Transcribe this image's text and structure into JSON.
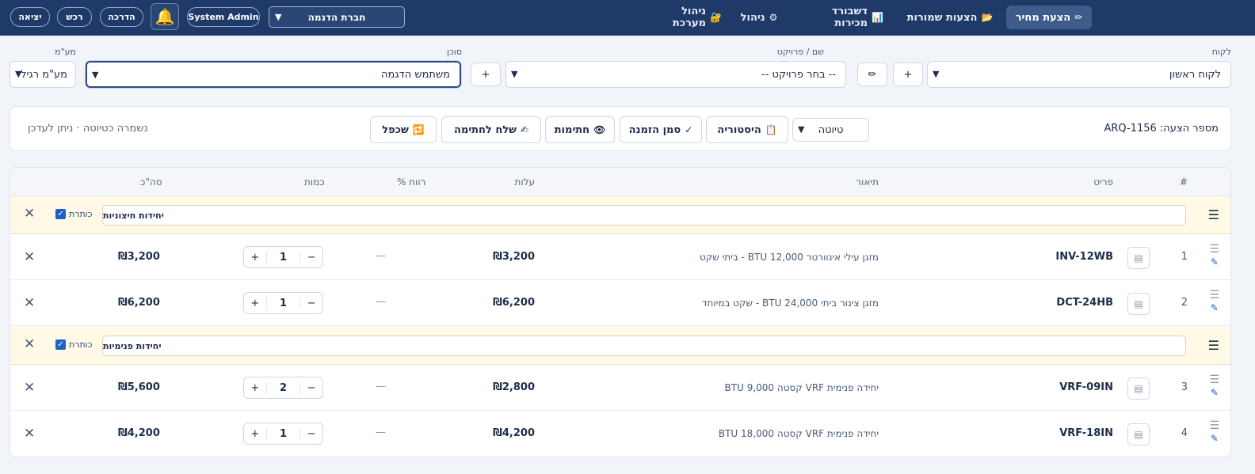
{
  "header": {
    "buttons": {
      "logout": "יציאה",
      "purchase": "רכש",
      "guide": "הדרכה",
      "user": "System Admin"
    },
    "company": "חברת הדגמה",
    "nav": [
      {
        "label": "הצעת מחיר",
        "icon": "✏"
      },
      {
        "label": "הצעות שמורות",
        "icon": "📂"
      },
      {
        "label": "דשבורד מכירות",
        "icon": "📊"
      },
      {
        "label": "ניהול",
        "icon": "⚙"
      },
      {
        "label": "ניהול מערכת",
        "icon": "🔐"
      }
    ]
  },
  "filters": {
    "customer_label": "לקוח",
    "customer_value": "לקוח ראשון",
    "project_label": "שם / פרויקט",
    "project_value": "-- בחר פרויקט --",
    "agent_label": "סוכן",
    "agent_value": "משתמש הדגמה",
    "vat_label": "מע\"מ",
    "vat_value": "מע\"מ רגיל",
    "plus": "+",
    "edit_icon": "✏"
  },
  "proposal": {
    "number": "מספר הצעה: ARQ-1156",
    "saved_status": "נשמרה כטיוטה · ניתן לעדכן",
    "status_value": "טיוטה",
    "buttons": {
      "history": "היסטוריה",
      "mark_order": "סמן הזמנה",
      "signatures": "חתימות",
      "send_signature": "שלח לחתימה",
      "duplicate": "שכפל"
    },
    "icons": {
      "history": "📋",
      "mark_order": "✓",
      "signatures": "👁",
      "send_signature": "✍",
      "duplicate": "🔁"
    }
  },
  "table": {
    "headers": {
      "index": "#",
      "item": "פריט",
      "description": "תיאור",
      "cost": "עלות",
      "profit": "רווח %",
      "quantity": "כמות",
      "total": "סה\"כ"
    },
    "header_checkbox_label": "כותרת",
    "groups": [
      {
        "title": "יחידות חיצוניות",
        "rows": [
          {
            "index": "1",
            "sku": "INV-12WB",
            "description": "מזגן עילי אינוורטר 12,000 BTU - ביתי שקט",
            "cost": "₪3,200",
            "profit": "—",
            "qty": "1",
            "total": "₪3,200"
          },
          {
            "index": "2",
            "sku": "DCT-24HB",
            "description": "מזגן צינור ביתי 24,000 BTU - שקט במיוחד",
            "cost": "₪6,200",
            "profit": "—",
            "qty": "1",
            "total": "₪6,200"
          }
        ]
      },
      {
        "title": "יחידות פנימיות",
        "rows": [
          {
            "index": "3",
            "sku": "VRF-09IN",
            "description": "יחידה פנימית VRF קסטה 9,000 BTU",
            "cost": "₪2,800",
            "profit": "—",
            "qty": "2",
            "total": "₪5,600"
          },
          {
            "index": "4",
            "sku": "VRF-18IN",
            "description": "יחידה פנימית VRF קסטה 18,000 BTU",
            "cost": "₪4,200",
            "profit": "—",
            "qty": "1",
            "total": "₪4,200"
          }
        ]
      }
    ]
  }
}
